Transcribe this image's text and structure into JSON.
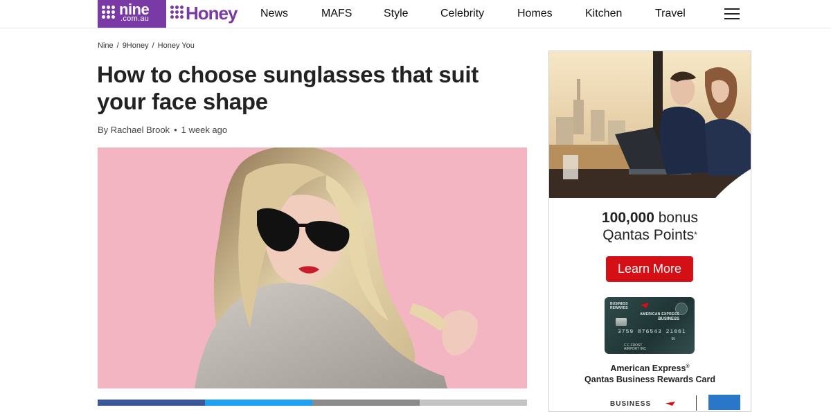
{
  "header": {
    "nine_logo_main": "nine",
    "nine_logo_sub": ".com.au",
    "honey_logo": "Honey",
    "nav": [
      "News",
      "MAFS",
      "Style",
      "Celebrity",
      "Homes",
      "Kitchen",
      "Travel"
    ],
    "menu_icon": "hamburger-menu-icon"
  },
  "breadcrumb": [
    "Nine",
    "9Honey",
    "Honey You"
  ],
  "breadcrumb_separator": "/",
  "article": {
    "title": "How to choose sunglasses that suit your face shape",
    "author": "By Rachael Brook",
    "byline_dot": "•",
    "date": "1 week ago"
  },
  "share_colors": [
    "#3b5998",
    "#1da1f2",
    "#8a8a8a",
    "#c4c4c4"
  ],
  "ad": {
    "headline_bold": "100,000",
    "headline_rest": " bonus",
    "headline_line2": "Qantas Points",
    "headline_mark": "*",
    "button_label": "Learn More",
    "card_brand_line1": "BUSINESS",
    "card_brand_line2": "REWARDS",
    "card_issuer": "AMERICAN EXPRESS",
    "card_type": "BUSINESS",
    "card_number": "3759 876543 21001",
    "card_expiry": "95",
    "card_holder_line1": "C F FROST",
    "card_holder_line2": "AIRPORT INC",
    "caption_line1": "American Express",
    "caption_reg": "®",
    "caption_line2": "Qantas Business Rewards Card",
    "footer_text": "BUSINESS"
  },
  "colors": {
    "brand_purple": "#7a3aa5",
    "cta_red": "#d50f16",
    "hero_bg": "#f3b5c2"
  }
}
